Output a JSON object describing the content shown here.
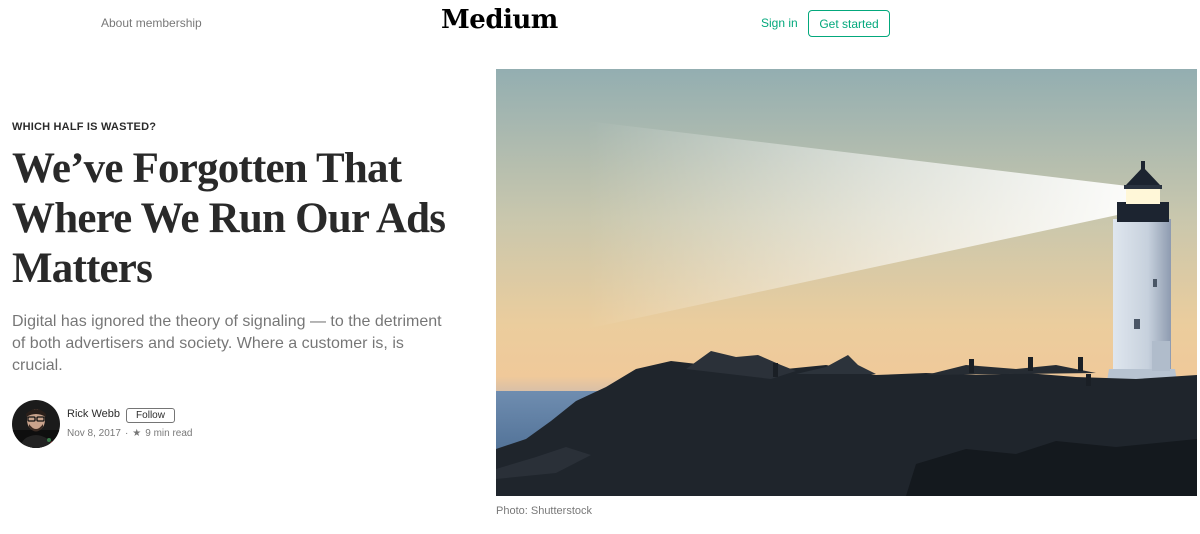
{
  "header": {
    "membership_link": "About membership",
    "logo": "Medium",
    "sign_in": "Sign in",
    "get_started": "Get started"
  },
  "article": {
    "kicker": "WHICH HALF IS WASTED?",
    "title": "We’ve Forgotten That Where We Run Our Ads Matters",
    "subtitle": "Digital has ignored the theory of signaling — to the detriment of both advertisers and society. Where a customer is, is crucial.",
    "author": {
      "name": "Rick Webb",
      "follow_label": "Follow",
      "date": "Nov 8, 2017",
      "separator": "·",
      "star": "★",
      "read_time": "9 min read"
    },
    "hero_caption": "Photo: Shutterstock"
  },
  "colors": {
    "accent": "#03a87c",
    "text_primary": "rgba(0,0,0,0.84)",
    "text_secondary": "rgba(0,0,0,0.54)"
  }
}
